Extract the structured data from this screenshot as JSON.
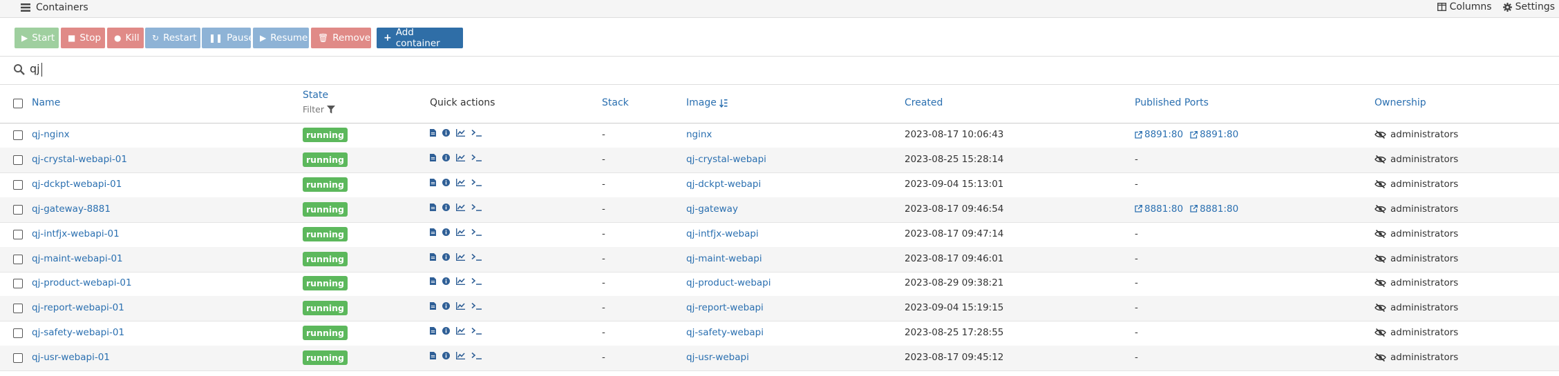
{
  "header": {
    "title": "Containers",
    "columns_label": "Columns",
    "settings_label": "Settings"
  },
  "toolbar": {
    "start": "Start",
    "stop": "Stop",
    "kill": "Kill",
    "restart": "Restart",
    "pause": "Pause",
    "resume": "Resume",
    "remove": "Remove",
    "add": "Add container"
  },
  "search": {
    "value": "qj"
  },
  "table": {
    "headers": {
      "name": "Name",
      "state": "State",
      "state_filter": "Filter",
      "quick_actions": "Quick actions",
      "stack": "Stack",
      "image": "Image",
      "created": "Created",
      "ports": "Published Ports",
      "ownership": "Ownership"
    },
    "rows": [
      {
        "name": "qj-nginx",
        "state": "running",
        "stack": "-",
        "image": "nginx",
        "created": "2023-08-17 10:06:43",
        "ports": [
          "8891:80",
          "8891:80"
        ],
        "ownership": "administrators"
      },
      {
        "name": "qj-crystal-webapi-01",
        "state": "running",
        "stack": "-",
        "image": "qj-crystal-webapi",
        "created": "2023-08-25 15:28:14",
        "ports": [],
        "ports_empty": "-",
        "ownership": "administrators"
      },
      {
        "name": "qj-dckpt-webapi-01",
        "state": "running",
        "stack": "-",
        "image": "qj-dckpt-webapi",
        "created": "2023-09-04 15:13:01",
        "ports": [],
        "ports_empty": "-",
        "ownership": "administrators"
      },
      {
        "name": "qj-gateway-8881",
        "state": "running",
        "stack": "-",
        "image": "qj-gateway",
        "created": "2023-08-17 09:46:54",
        "ports": [
          "8881:80",
          "8881:80"
        ],
        "ownership": "administrators"
      },
      {
        "name": "qj-intfjx-webapi-01",
        "state": "running",
        "stack": "-",
        "image": "qj-intfjx-webapi",
        "created": "2023-08-17 09:47:14",
        "ports": [],
        "ports_empty": "-",
        "ownership": "administrators"
      },
      {
        "name": "qj-maint-webapi-01",
        "state": "running",
        "stack": "-",
        "image": "qj-maint-webapi",
        "created": "2023-08-17 09:46:01",
        "ports": [],
        "ports_empty": "-",
        "ownership": "administrators"
      },
      {
        "name": "qj-product-webapi-01",
        "state": "running",
        "stack": "-",
        "image": "qj-product-webapi",
        "created": "2023-08-29 09:38:21",
        "ports": [],
        "ports_empty": "-",
        "ownership": "administrators"
      },
      {
        "name": "qj-report-webapi-01",
        "state": "running",
        "stack": "-",
        "image": "qj-report-webapi",
        "created": "2023-09-04 15:19:15",
        "ports": [],
        "ports_empty": "-",
        "ownership": "administrators"
      },
      {
        "name": "qj-safety-webapi-01",
        "state": "running",
        "stack": "-",
        "image": "qj-safety-webapi",
        "created": "2023-08-25 17:28:55",
        "ports": [],
        "ports_empty": "-",
        "ownership": "administrators"
      },
      {
        "name": "qj-usr-webapi-01",
        "state": "running",
        "stack": "-",
        "image": "qj-usr-webapi",
        "created": "2023-08-17 09:45:12",
        "ports": [],
        "ports_empty": "-",
        "ownership": "administrators"
      }
    ]
  },
  "colors": {
    "start_btn": "#9fcf9f",
    "stop_btn": "#e08a87",
    "kill_btn": "#e08a87",
    "restart_btn": "#8eb3d6",
    "pause_btn": "#8eb3d6",
    "resume_btn": "#8eb3d6",
    "remove_btn": "#e08a87",
    "add_btn": "#2f6ea7",
    "running_badge": "#5cb85c",
    "link": "#2a6fb0"
  },
  "icons": {
    "title": "list-icon",
    "columns": "columns-icon",
    "settings": "gear-icon",
    "search": "search-icon",
    "filter": "filter-icon",
    "sort": "sort-icon",
    "quick_actions": [
      "logs-icon",
      "inspect-icon",
      "stats-icon",
      "console-icon"
    ],
    "port_link": "external-link-icon",
    "ownership": "eye-slash-icon"
  }
}
